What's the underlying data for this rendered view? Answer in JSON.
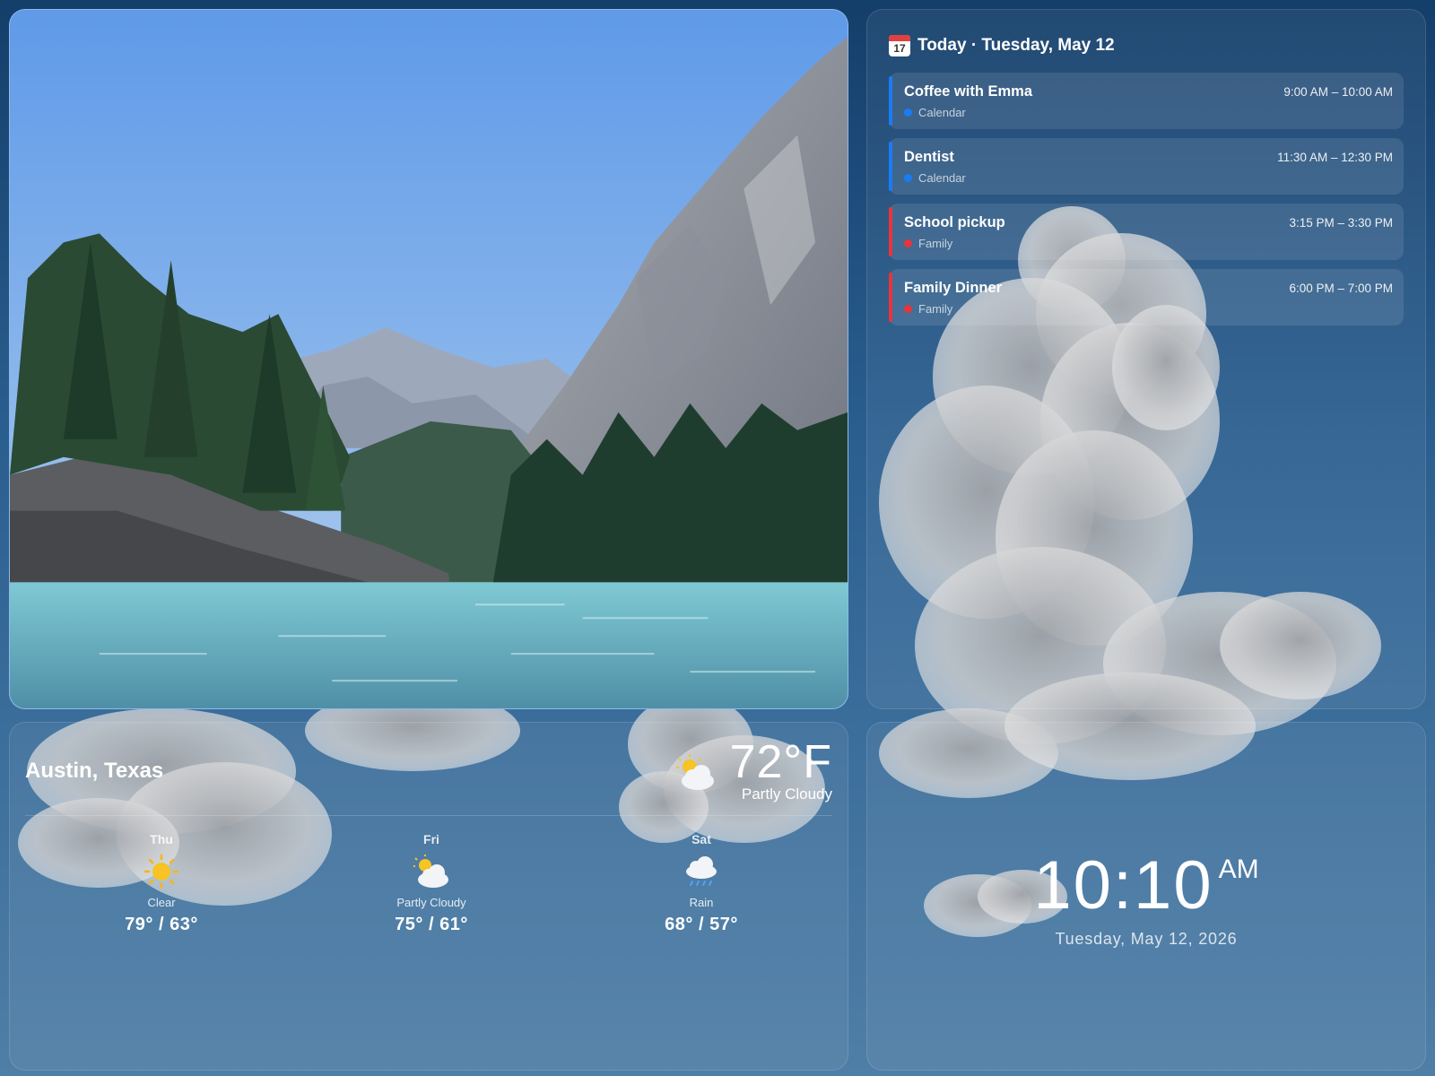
{
  "photo": {
    "alt": "Mountain river landscape"
  },
  "calendar": {
    "icon": "calendar-icon",
    "icon_day": "17",
    "header": "Today · Tuesday, May 12",
    "events": [
      {
        "title": "Coffee with Emma",
        "time": "9:00 AM – 10:00 AM",
        "calendar": "Calendar",
        "color": "#1a7cf5"
      },
      {
        "title": "Dentist",
        "time": "11:30 AM – 12:30 PM",
        "calendar": "Calendar",
        "color": "#1a7cf5"
      },
      {
        "title": "School pickup",
        "time": "3:15 PM – 3:30 PM",
        "calendar": "Family",
        "color": "#e8343c"
      },
      {
        "title": "Family Dinner",
        "time": "6:00 PM – 7:00 PM",
        "calendar": "Family",
        "color": "#e8343c"
      }
    ]
  },
  "weather": {
    "city": "Austin, Texas",
    "current": {
      "temp": "72°F",
      "condition": "Partly Cloudy",
      "icon": "partly-cloudy-icon"
    },
    "forecast": [
      {
        "day": "Thu",
        "condition": "Clear",
        "range": "79° / 63°",
        "icon": "sun-icon"
      },
      {
        "day": "Fri",
        "condition": "Partly Cloudy",
        "range": "75° / 61°",
        "icon": "partly-cloudy-icon"
      },
      {
        "day": "Sat",
        "condition": "Rain",
        "range": "68° / 57°",
        "icon": "rain-icon"
      }
    ]
  },
  "clock": {
    "time": "10:10",
    "ampm": "AM",
    "date": "Tuesday, May 12, 2026"
  }
}
